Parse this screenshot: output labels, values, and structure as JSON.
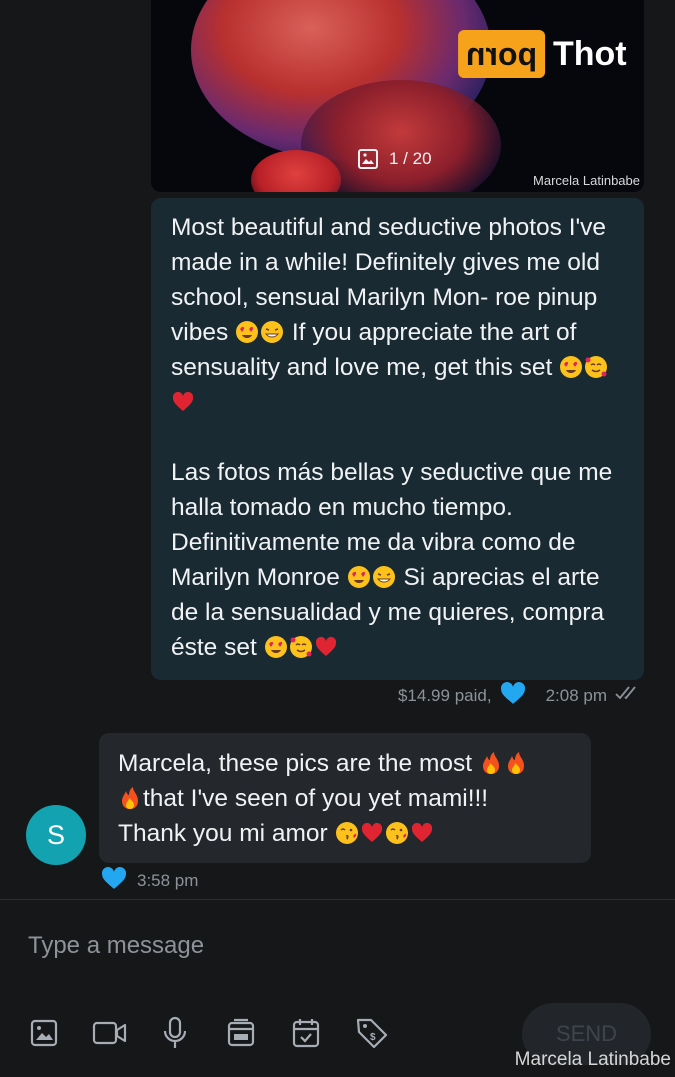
{
  "media": {
    "counter": "1 / 20",
    "credit": "Marcela Latinbabe",
    "watermark_box": "porn",
    "watermark_text": "Thot"
  },
  "sent_message": {
    "paragraph_en": "Most beautiful and seductive photos I've made in a while! Definitely gives me old school, sensual Marilyn Mon- roe pinup vibes",
    "paragraph_en_2": "If you appreciate the art of sensuality and love me, get this set",
    "paragraph_es": "Las fotos más bellas y seductive que me halla tomado en mucho tiempo. Definitivamente me da vibra como de Marilyn Monroe",
    "paragraph_es_2": "Si aprecias el arte de la sensualidad y me quieres, compra éste set",
    "price": "$14.99 paid,",
    "time": "2:08 pm"
  },
  "received_message": {
    "line1": "Marcela, these pics are the most",
    "line2": "that I've seen of you yet mami!!!",
    "line3": "Thank you mi amor",
    "avatar_letter": "S",
    "time": "3:58 pm"
  },
  "compose": {
    "placeholder": "Type a message",
    "send_label": "SEND",
    "tools": [
      "image-icon",
      "video-icon",
      "microphone-icon",
      "vault-icon",
      "calendar-icon",
      "price-tag-icon"
    ]
  },
  "footer_credit": "Marcela Latinbabe",
  "colors": {
    "background": "#151719",
    "sent_bubble": "#1a2a33",
    "received_bubble": "#24272b",
    "heart": "#22a7f0",
    "avatar": "#13a3b0",
    "watermark": "#f7a21b"
  }
}
